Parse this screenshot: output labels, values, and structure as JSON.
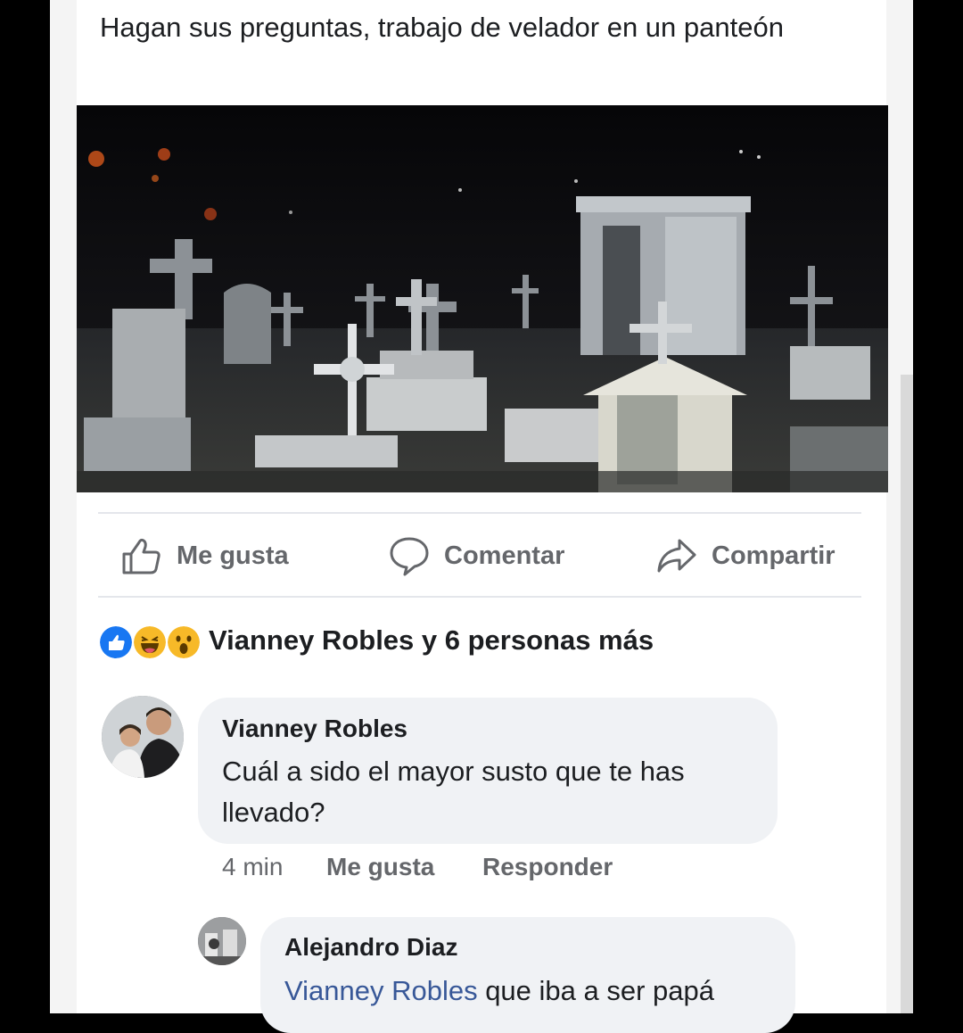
{
  "post": {
    "text": "Hagan sus preguntas, trabajo de velador en un panteón",
    "photo_icon": "cemetery-night-photo"
  },
  "actions": {
    "like_label": "Me gusta",
    "comment_label": "Comentar",
    "share_label": "Compartir"
  },
  "reactions": {
    "icons": [
      "like-reaction-icon",
      "haha-reaction-icon",
      "wow-reaction-icon"
    ],
    "summary": "Vianney Robles y 6 personas más"
  },
  "comment": {
    "author": "Vianney Robles",
    "text": "Cuál a sido el mayor susto que te has llevado?",
    "time": "4 min",
    "like_label": "Me gusta",
    "reply_label": "Responder"
  },
  "reply": {
    "author": "Alejandro Diaz",
    "mention": "Vianney Robles",
    "text": " que iba a ser papá"
  },
  "colors": {
    "mention": "#385898",
    "like_blue": "#1877f2",
    "reaction_yellow": "#f7b928",
    "muted_text": "#65676b",
    "bubble": "#f0f2f5"
  }
}
